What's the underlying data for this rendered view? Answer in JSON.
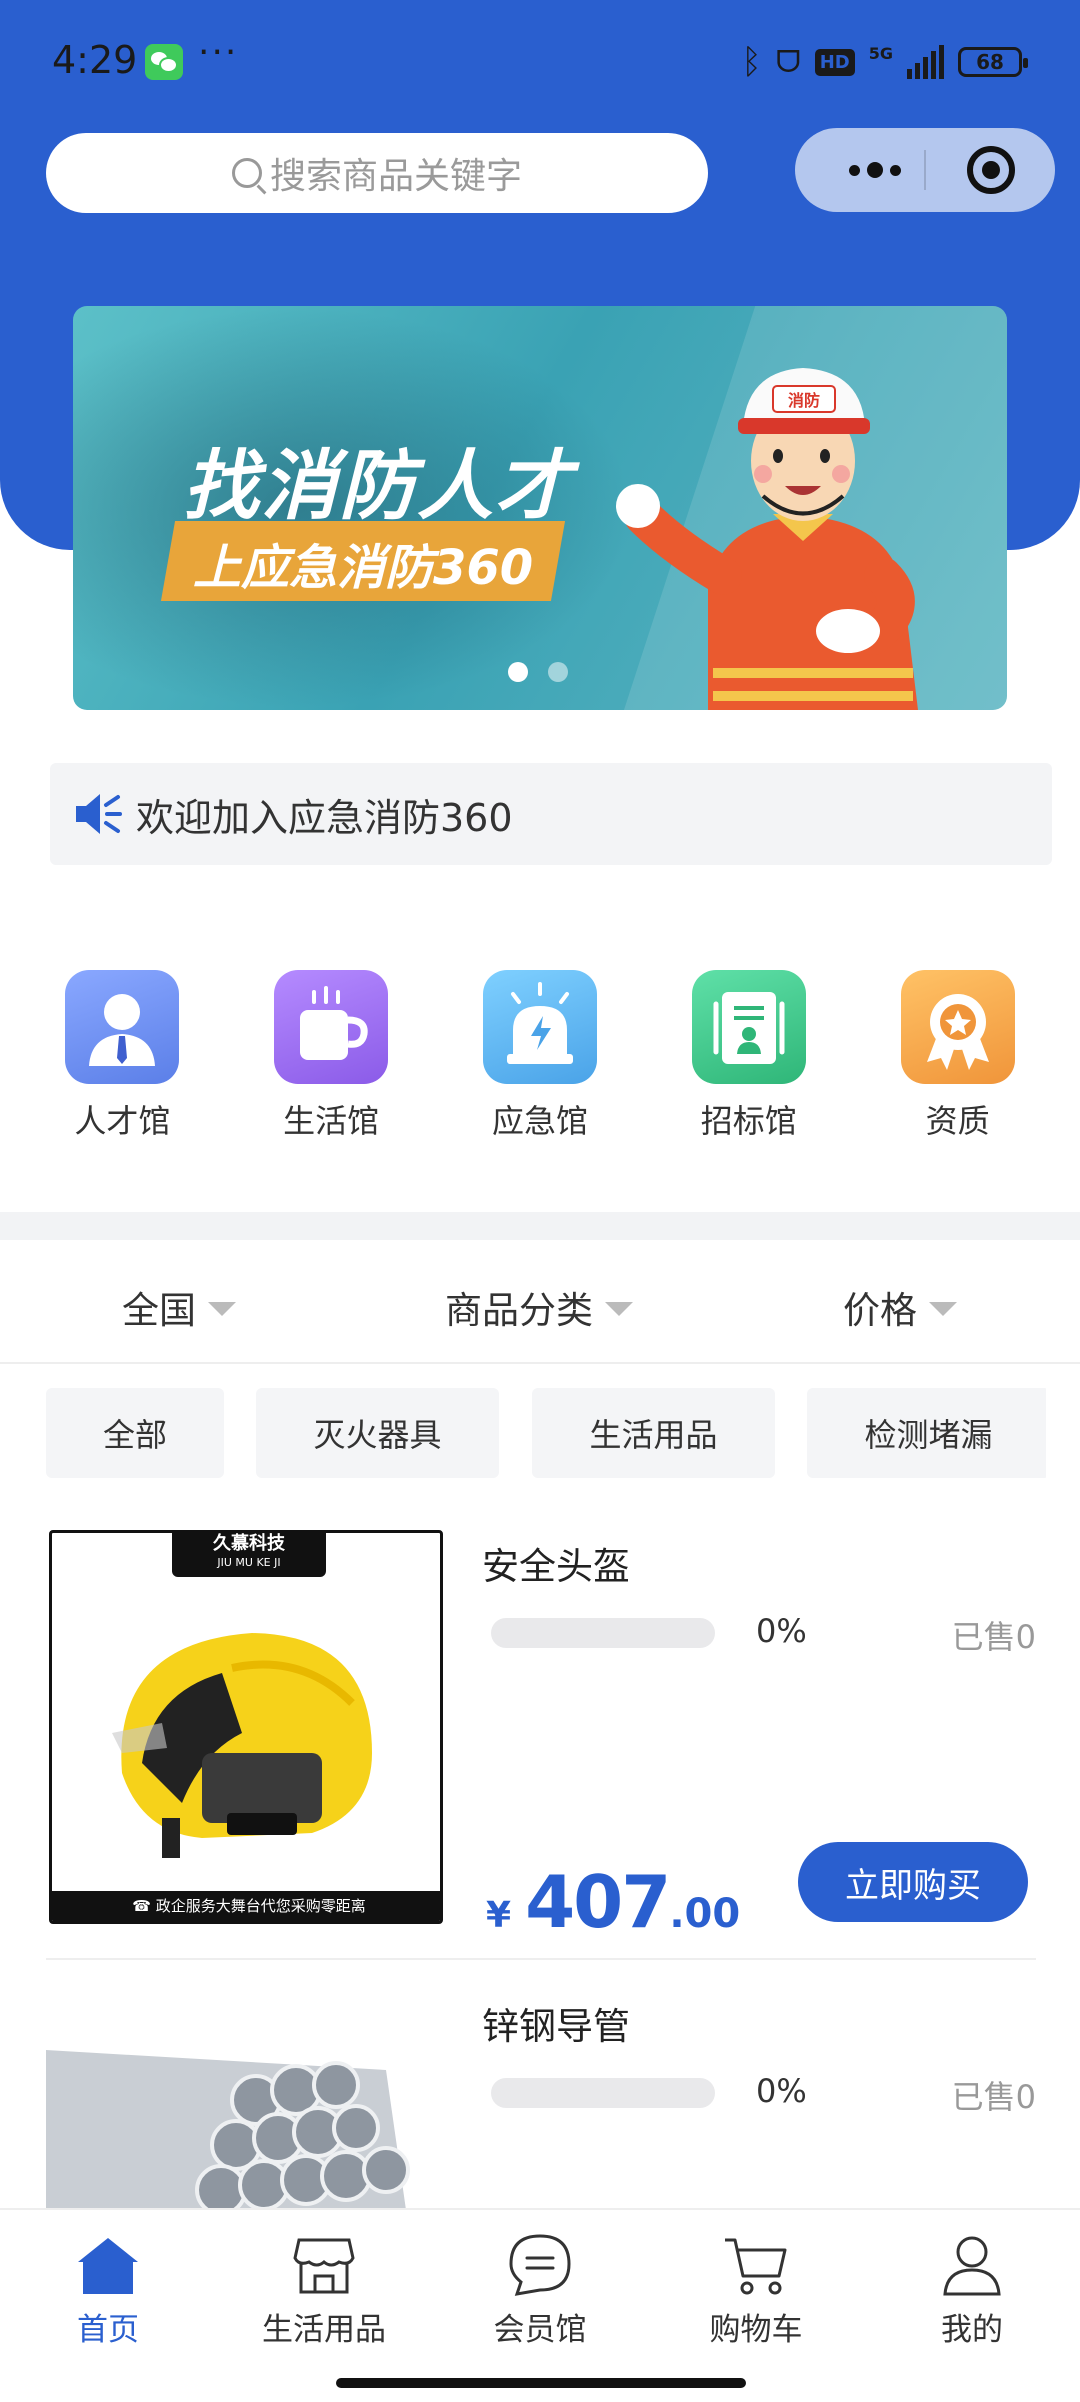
{
  "statusbar": {
    "time": "4:29",
    "dots": "···",
    "network": "5G",
    "hd": "HD",
    "battery": "68"
  },
  "search": {
    "placeholder": "搜索商品关键字"
  },
  "banner": {
    "title": "找消防人才",
    "subtitle": "上应急消防360",
    "helmet_text": "消防"
  },
  "notice": {
    "text": "欢迎加入应急消防360"
  },
  "categories": [
    {
      "label": "人才馆",
      "icon": "person-icon",
      "color": "#6b8ff0"
    },
    {
      "label": "生活馆",
      "icon": "cup-icon",
      "color": "#9a6cf0"
    },
    {
      "label": "应急馆",
      "icon": "alarm-light-icon",
      "color": "#5fb6ee"
    },
    {
      "label": "招标馆",
      "icon": "document-icon",
      "color": "#38c58a"
    },
    {
      "label": "资质",
      "icon": "award-badge-icon",
      "color": "#f2a64a"
    }
  ],
  "filters": {
    "region": "全国",
    "category": "商品分类",
    "price": "价格"
  },
  "chips": [
    "全部",
    "灭火器具",
    "生活用品",
    "检测堵漏"
  ],
  "products": [
    {
      "name": "安全头盔",
      "progress_pct": 0,
      "progress_label": "0%",
      "sold": "已售0",
      "price_symbol": "¥",
      "price_int": "407",
      "price_dec": ".00",
      "buy_label": "立即购买",
      "img_brand": "久慕科技",
      "img_brand_pinyin": "JIU MU KE JI",
      "img_footer": "☎ 政企服务大舞台代您采购零距离"
    },
    {
      "name": "锌钢导管",
      "progress_pct": 0,
      "progress_label": "0%",
      "sold": "已售0"
    }
  ],
  "tabbar": [
    {
      "label": "首页",
      "icon": "home-icon",
      "active": true
    },
    {
      "label": "生活用品",
      "icon": "shop-icon",
      "active": false
    },
    {
      "label": "会员馆",
      "icon": "chat-bubble-icon",
      "active": false
    },
    {
      "label": "购物车",
      "icon": "cart-icon",
      "active": false
    },
    {
      "label": "我的",
      "icon": "user-icon",
      "active": false
    }
  ],
  "colors": {
    "primary": "#2a5fcf",
    "notice_bg": "#f3f4f6",
    "chip_bg": "#f4f5f7"
  }
}
